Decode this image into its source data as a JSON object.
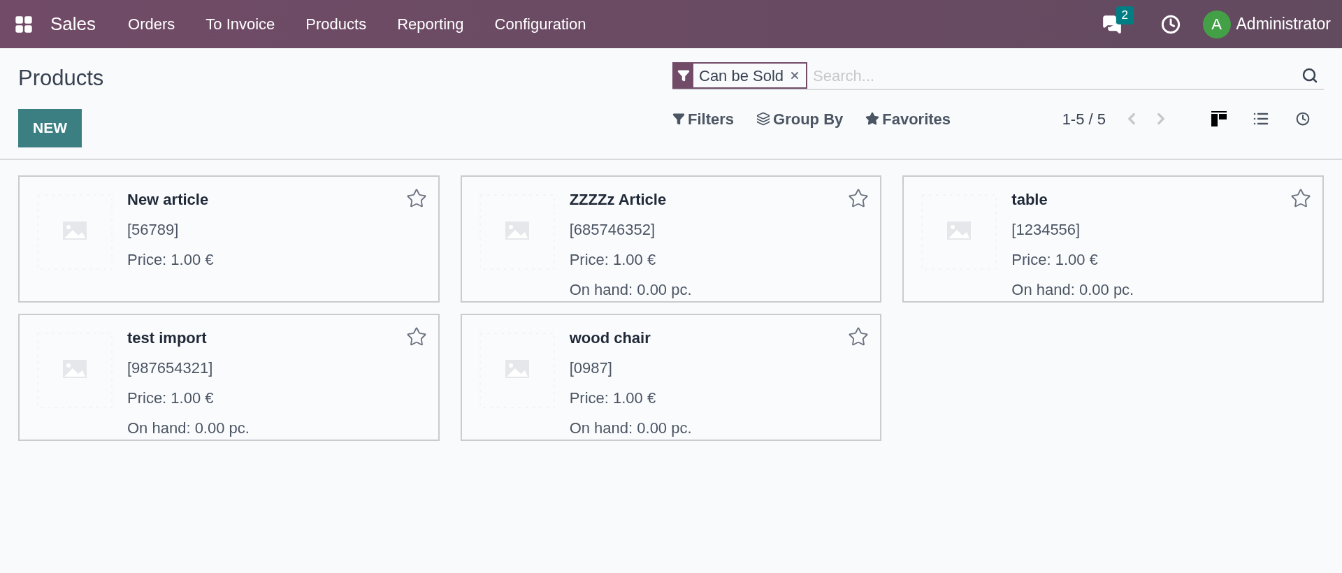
{
  "navbar": {
    "app": "Sales",
    "menu": [
      "Orders",
      "To Invoice",
      "Products",
      "Reporting",
      "Configuration"
    ],
    "messages_count": "2",
    "avatar_letter": "A",
    "user": "Administrator"
  },
  "title": "Products",
  "new_button": "NEW",
  "search": {
    "facet": "Can be Sold",
    "placeholder": "Search..."
  },
  "search_options": [
    "Filters",
    "Group By",
    "Favorites"
  ],
  "pager": "1-5 / 5",
  "views": [
    {
      "kind": "kanban",
      "selected": true
    },
    {
      "kind": "list",
      "selected": false
    },
    {
      "kind": "activity",
      "selected": false
    }
  ],
  "cards": [
    {
      "name": "New article",
      "reference": "[56789]",
      "price": "Price: 1.00 €",
      "favorite": false
    },
    {
      "name": "ZZZZz Article",
      "reference": "[685746352]",
      "price": "Price: 1.00 €",
      "on_hand": "On hand: 0.00 pc.",
      "favorite": false
    },
    {
      "name": "table",
      "reference": "[1234556]",
      "price": "Price: 1.00 €",
      "on_hand": "On hand: 0.00 pc.",
      "favorite": false
    },
    {
      "name": "test import",
      "reference": "[987654321]",
      "price": "Price: 1.00 €",
      "on_hand": "On hand: 0.00 pc.",
      "favorite": false
    },
    {
      "name": "wood chair",
      "reference": "[0987]",
      "price": "Price: 1.00 €",
      "on_hand": "On hand: 0.00 pc.",
      "favorite": false
    }
  ]
}
